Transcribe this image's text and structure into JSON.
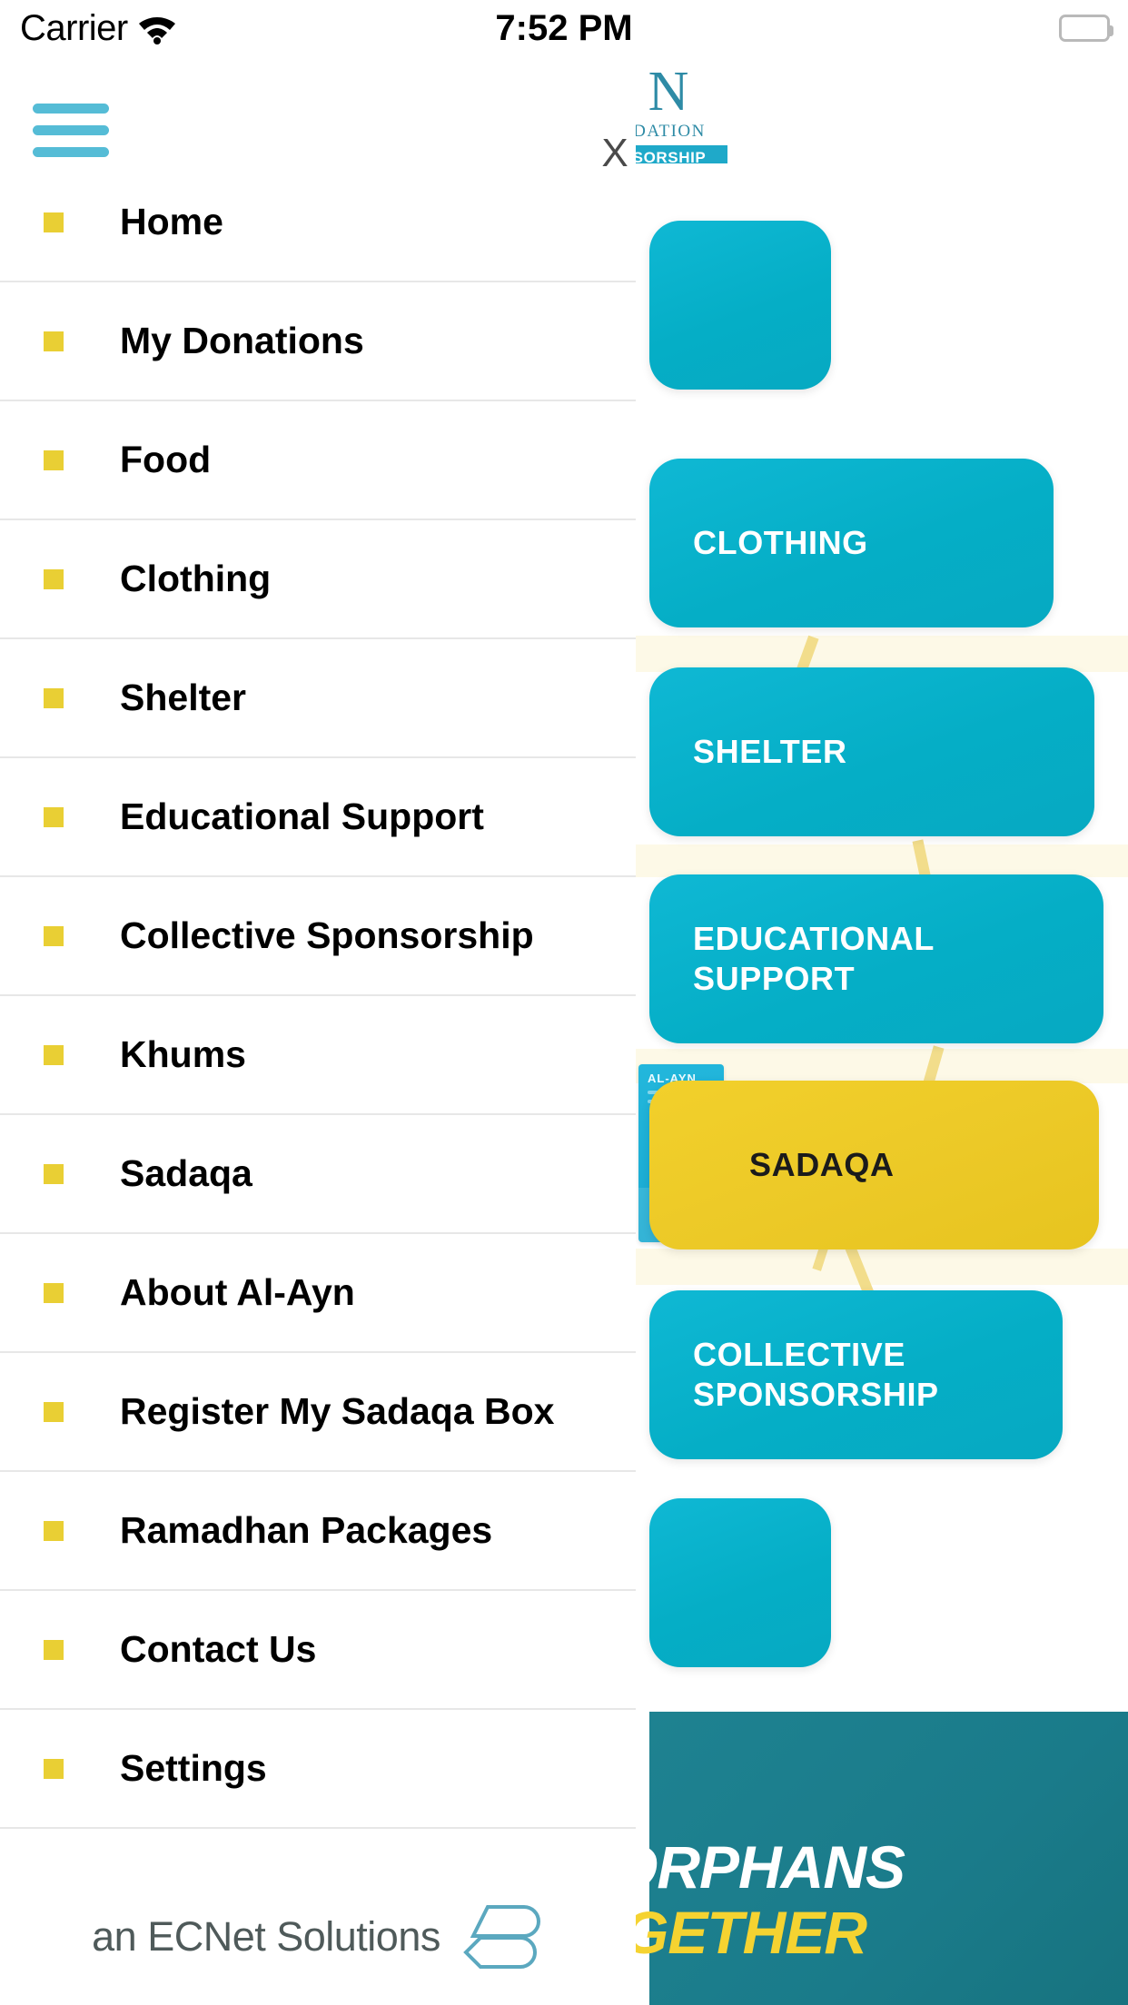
{
  "status_bar": {
    "carrier": "Carrier",
    "wifi_icon": "wifi-icon",
    "time": "7:52 PM",
    "battery_icon": "battery-full-icon"
  },
  "header": {
    "menu_icon": "hamburger-menu-icon",
    "close_label": "X",
    "logo": {
      "mark": "N",
      "line1": "DATION",
      "badge": "SORSHIP"
    }
  },
  "sidebar": {
    "items": [
      {
        "label": "Home",
        "bullet": "square-bullet-icon"
      },
      {
        "label": "My Donations",
        "bullet": "square-bullet-icon"
      },
      {
        "label": "Food",
        "bullet": "square-bullet-icon"
      },
      {
        "label": "Clothing",
        "bullet": "square-bullet-icon"
      },
      {
        "label": "Shelter",
        "bullet": "square-bullet-icon"
      },
      {
        "label": "Educational Support",
        "bullet": "square-bullet-icon"
      },
      {
        "label": "Collective Sponsorship",
        "bullet": "square-bullet-icon"
      },
      {
        "label": "Khums",
        "bullet": "square-bullet-icon"
      },
      {
        "label": "Sadaqa",
        "bullet": "square-bullet-icon"
      },
      {
        "label": "About Al-Ayn",
        "bullet": "square-bullet-icon"
      },
      {
        "label": "Register My Sadaqa Box",
        "bullet": "square-bullet-icon"
      },
      {
        "label": "Ramadhan Packages",
        "bullet": "square-bullet-icon"
      },
      {
        "label": "Contact Us",
        "bullet": "square-bullet-icon"
      },
      {
        "label": "Settings",
        "bullet": "square-bullet-icon"
      }
    ]
  },
  "footer": {
    "text": "an ECNet Solutions",
    "logo_icon": "ecnet-stacked-logo-icon"
  },
  "background": {
    "cards": [
      {
        "label": "",
        "color": "#06aec6"
      },
      {
        "label": "CLOTHING",
        "color": "#06aec6"
      },
      {
        "label": "SHELTER",
        "color": "#06aec6"
      },
      {
        "label": "EDUCATIONAL SUPPORT",
        "color": "#06aec6"
      },
      {
        "label": "SADAQA",
        "color": "#ecc927"
      },
      {
        "label": "COLLECTIVE SPONSORSHIP",
        "color": "#06aec6"
      },
      {
        "label": "",
        "color": "#06aec6"
      }
    ],
    "sadaqa_box": {
      "brand": "AL-AYN",
      "icon": "donation-box-icon"
    },
    "banner": {
      "line1": "ORPHANS",
      "line2": "GETHER",
      "bg_color": "#1a7b8a",
      "line1_color": "#ffffff",
      "line2_color": "#f5d331"
    }
  },
  "colors": {
    "accent_cyan": "#06aec6",
    "accent_yellow": "#e9cf34",
    "menu_icon": "#55bcd6",
    "divider": "#e7e7e7",
    "text": "#000000"
  }
}
